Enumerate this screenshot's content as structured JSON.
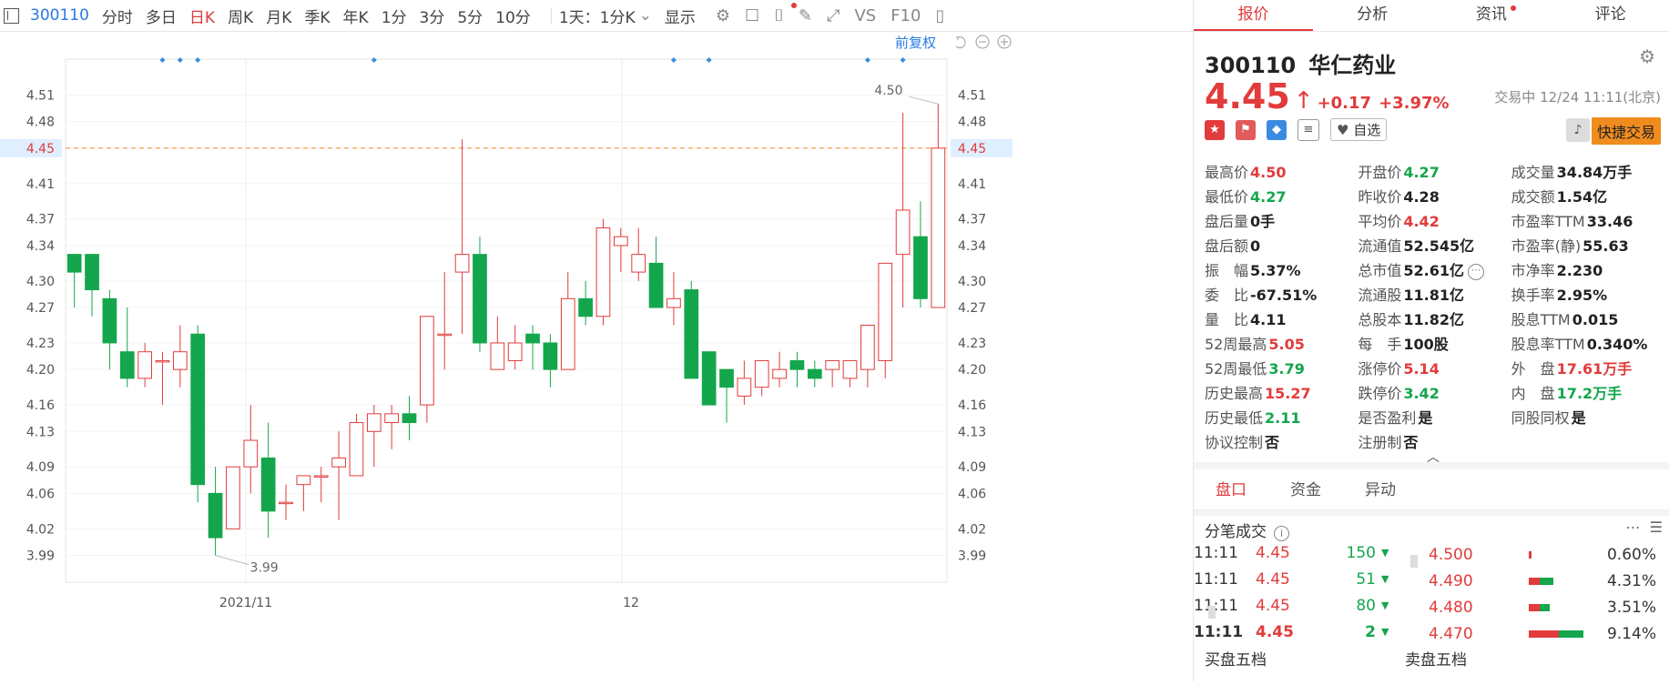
{
  "toolbar": {
    "code": "300110",
    "items": [
      "分时",
      "多日",
      "日K",
      "周K",
      "月K",
      "季K",
      "年K",
      "1分",
      "3分",
      "5分",
      "10分"
    ],
    "active": "日K",
    "period_select": "1天：1分K",
    "display_label": "显示",
    "vs_label": "VS",
    "f10_label": "F10"
  },
  "chart": {
    "restore_label": "前复权",
    "current_price": "4.45",
    "high_label": "4.50",
    "low_label": "3.99",
    "x_labels": [
      "2021/11",
      "12"
    ]
  },
  "chart_data": {
    "type": "candlestick",
    "ylim": [
      3.97,
      4.53
    ],
    "y_ticks": [
      "4.51",
      "4.48",
      "4.45",
      "4.41",
      "4.37",
      "4.34",
      "4.30",
      "4.27",
      "4.23",
      "4.20",
      "4.16",
      "4.13",
      "4.09",
      "4.06",
      "4.02",
      "3.99"
    ],
    "candles": [
      {
        "o": 4.33,
        "h": 4.33,
        "l": 4.27,
        "c": 4.31
      },
      {
        "o": 4.33,
        "h": 4.33,
        "l": 4.26,
        "c": 4.29
      },
      {
        "o": 4.28,
        "h": 4.29,
        "l": 4.2,
        "c": 4.23
      },
      {
        "o": 4.22,
        "h": 4.27,
        "l": 4.18,
        "c": 4.19
      },
      {
        "o": 4.19,
        "h": 4.23,
        "l": 4.18,
        "c": 4.22
      },
      {
        "o": 4.21,
        "h": 4.22,
        "l": 4.16,
        "c": 4.21
      },
      {
        "o": 4.2,
        "h": 4.25,
        "l": 4.18,
        "c": 4.22
      },
      {
        "o": 4.24,
        "h": 4.25,
        "l": 4.05,
        "c": 4.07
      },
      {
        "o": 4.06,
        "h": 4.09,
        "l": 3.99,
        "c": 4.01
      },
      {
        "o": 4.02,
        "h": 4.09,
        "l": 4.02,
        "c": 4.09
      },
      {
        "o": 4.09,
        "h": 4.16,
        "l": 4.06,
        "c": 4.12
      },
      {
        "o": 4.1,
        "h": 4.14,
        "l": 4.01,
        "c": 4.04
      },
      {
        "o": 4.05,
        "h": 4.07,
        "l": 4.03,
        "c": 4.05
      },
      {
        "o": 4.07,
        "h": 4.08,
        "l": 4.04,
        "c": 4.08
      },
      {
        "o": 4.08,
        "h": 4.09,
        "l": 4.05,
        "c": 4.08
      },
      {
        "o": 4.09,
        "h": 4.13,
        "l": 4.03,
        "c": 4.1
      },
      {
        "o": 4.08,
        "h": 4.15,
        "l": 4.08,
        "c": 4.14
      },
      {
        "o": 4.13,
        "h": 4.16,
        "l": 4.09,
        "c": 4.15
      },
      {
        "o": 4.14,
        "h": 4.16,
        "l": 4.11,
        "c": 4.15
      },
      {
        "o": 4.15,
        "h": 4.17,
        "l": 4.12,
        "c": 4.14
      },
      {
        "o": 4.16,
        "h": 4.26,
        "l": 4.14,
        "c": 4.26
      },
      {
        "o": 4.24,
        "h": 4.31,
        "l": 4.2,
        "c": 4.24
      },
      {
        "o": 4.31,
        "h": 4.46,
        "l": 4.24,
        "c": 4.33
      },
      {
        "o": 4.33,
        "h": 4.35,
        "l": 4.22,
        "c": 4.23
      },
      {
        "o": 4.2,
        "h": 4.26,
        "l": 4.2,
        "c": 4.23
      },
      {
        "o": 4.21,
        "h": 4.25,
        "l": 4.2,
        "c": 4.23
      },
      {
        "o": 4.24,
        "h": 4.25,
        "l": 4.2,
        "c": 4.23
      },
      {
        "o": 4.23,
        "h": 4.24,
        "l": 4.18,
        "c": 4.2
      },
      {
        "o": 4.2,
        "h": 4.31,
        "l": 4.2,
        "c": 4.28
      },
      {
        "o": 4.28,
        "h": 4.3,
        "l": 4.25,
        "c": 4.26
      },
      {
        "o": 4.26,
        "h": 4.37,
        "l": 4.25,
        "c": 4.36
      },
      {
        "o": 4.34,
        "h": 4.36,
        "l": 4.31,
        "c": 4.35
      },
      {
        "o": 4.31,
        "h": 4.36,
        "l": 4.3,
        "c": 4.33
      },
      {
        "o": 4.32,
        "h": 4.35,
        "l": 4.27,
        "c": 4.27
      },
      {
        "o": 4.27,
        "h": 4.31,
        "l": 4.25,
        "c": 4.28
      },
      {
        "o": 4.29,
        "h": 4.3,
        "l": 4.19,
        "c": 4.19
      },
      {
        "o": 4.22,
        "h": 4.22,
        "l": 4.16,
        "c": 4.16
      },
      {
        "o": 4.2,
        "h": 4.2,
        "l": 4.14,
        "c": 4.18
      },
      {
        "o": 4.17,
        "h": 4.21,
        "l": 4.16,
        "c": 4.19
      },
      {
        "o": 4.18,
        "h": 4.21,
        "l": 4.17,
        "c": 4.21
      },
      {
        "o": 4.19,
        "h": 4.22,
        "l": 4.18,
        "c": 4.2
      },
      {
        "o": 4.21,
        "h": 4.22,
        "l": 4.18,
        "c": 4.2
      },
      {
        "o": 4.2,
        "h": 4.21,
        "l": 4.18,
        "c": 4.19
      },
      {
        "o": 4.2,
        "h": 4.21,
        "l": 4.18,
        "c": 4.21
      },
      {
        "o": 4.19,
        "h": 4.21,
        "l": 4.18,
        "c": 4.21
      },
      {
        "o": 4.2,
        "h": 4.25,
        "l": 4.18,
        "c": 4.25
      },
      {
        "o": 4.21,
        "h": 4.32,
        "l": 4.19,
        "c": 4.32
      },
      {
        "o": 4.33,
        "h": 4.49,
        "l": 4.27,
        "c": 4.38
      },
      {
        "o": 4.35,
        "h": 4.39,
        "l": 4.27,
        "c": 4.28
      },
      {
        "o": 4.27,
        "h": 4.5,
        "l": 4.27,
        "c": 4.45
      }
    ],
    "markers_at": [
      5,
      6,
      7,
      17,
      34,
      36,
      45,
      47
    ]
  },
  "panel": {
    "tabs": [
      {
        "label": "报价",
        "active": true,
        "dot": false
      },
      {
        "label": "分析",
        "active": false,
        "dot": false
      },
      {
        "label": "资讯",
        "active": false,
        "dot": true
      },
      {
        "label": "评论",
        "active": false,
        "dot": false
      }
    ],
    "code": "300110",
    "name": "华仁药业",
    "price": "4.45",
    "change": "+0.17",
    "change_pct": "+3.97%",
    "status": "交易中 12/24 11:11(北京)",
    "watch_label": "自选",
    "quick_trade": "快捷交易",
    "stats": [
      [
        {
          "l": "最高价",
          "v": "4.50",
          "c": "red"
        },
        {
          "l": "开盘价",
          "v": "4.27",
          "c": "green"
        },
        {
          "l": "成交量",
          "v": "34.84万手",
          "c": ""
        }
      ],
      [
        {
          "l": "最低价",
          "v": "4.27",
          "c": "green"
        },
        {
          "l": "昨收价",
          "v": "4.28",
          "c": ""
        },
        {
          "l": "成交额",
          "v": "1.54亿",
          "c": ""
        }
      ],
      [
        {
          "l": "盘后量",
          "v": "0手",
          "c": ""
        },
        {
          "l": "平均价",
          "v": "4.42",
          "c": "red"
        },
        {
          "l": "市盈率TTM",
          "v": "33.46",
          "c": ""
        }
      ],
      [
        {
          "l": "盘后额",
          "v": "0",
          "c": ""
        },
        {
          "l": "流通值",
          "v": "52.545亿",
          "c": ""
        },
        {
          "l": "市盈率(静)",
          "v": "55.63",
          "c": ""
        }
      ],
      [
        {
          "l": "振　幅",
          "v": "5.37%",
          "c": ""
        },
        {
          "l": "总市值",
          "v": "52.61亿",
          "c": ""
        },
        {
          "l": "市净率",
          "v": "2.230",
          "c": ""
        }
      ],
      [
        {
          "l": "委　比",
          "v": "-67.51%",
          "c": ""
        },
        {
          "l": "流通股",
          "v": "11.81亿",
          "c": ""
        },
        {
          "l": "换手率",
          "v": "2.95%",
          "c": ""
        }
      ],
      [
        {
          "l": "量　比",
          "v": "4.11",
          "c": ""
        },
        {
          "l": "总股本",
          "v": "11.82亿",
          "c": ""
        },
        {
          "l": "股息TTM",
          "v": "0.015",
          "c": ""
        }
      ],
      [
        {
          "l": "52周最高",
          "v": "5.05",
          "c": "red"
        },
        {
          "l": "每　手",
          "v": "100股",
          "c": ""
        },
        {
          "l": "股息率TTM",
          "v": "0.340%",
          "c": ""
        }
      ],
      [
        {
          "l": "52周最低",
          "v": "3.79",
          "c": "green"
        },
        {
          "l": "涨停价",
          "v": "5.14",
          "c": "red"
        },
        {
          "l": "外　盘",
          "v": "17.61万手",
          "c": "red"
        }
      ],
      [
        {
          "l": "历史最高",
          "v": "15.27",
          "c": "red"
        },
        {
          "l": "跌停价",
          "v": "3.42",
          "c": "green"
        },
        {
          "l": "内　盘",
          "v": "17.2万手",
          "c": "green"
        }
      ],
      [
        {
          "l": "历史最低",
          "v": "2.11",
          "c": "green"
        },
        {
          "l": "是否盈利",
          "v": "是",
          "c": ""
        },
        {
          "l": "同股同权",
          "v": "是",
          "c": ""
        }
      ],
      [
        {
          "l": "协议控制",
          "v": "否",
          "c": ""
        },
        {
          "l": "注册制",
          "v": "否",
          "c": ""
        },
        {
          "l": "",
          "v": "",
          "c": ""
        }
      ]
    ],
    "subtabs": [
      "盘口",
      "资金",
      "异动"
    ],
    "trades_title": "分笔成交",
    "ticks": [
      {
        "t": "11:11",
        "p": "4.45",
        "q": "150",
        "bold": false
      },
      {
        "t": "11:11",
        "p": "4.45",
        "q": "51",
        "bold": false
      },
      {
        "t": "11:11",
        "p": "4.45",
        "q": "80",
        "bold": false
      },
      {
        "t": "11:11",
        "p": "4.45",
        "q": "2",
        "bold": true
      }
    ],
    "depth": [
      {
        "p": "4.500",
        "pct": "0.60%",
        "r": 0.05,
        "g": 0.0
      },
      {
        "p": "4.490",
        "pct": "4.31%",
        "r": 0.2,
        "g": 0.25
      },
      {
        "p": "4.480",
        "pct": "3.51%",
        "r": 0.2,
        "g": 0.18
      },
      {
        "p": "4.470",
        "pct": "9.14%",
        "r": 0.55,
        "g": 0.45
      }
    ],
    "bottom_left": "买盘五档",
    "bottom_right": "卖盘五档"
  }
}
